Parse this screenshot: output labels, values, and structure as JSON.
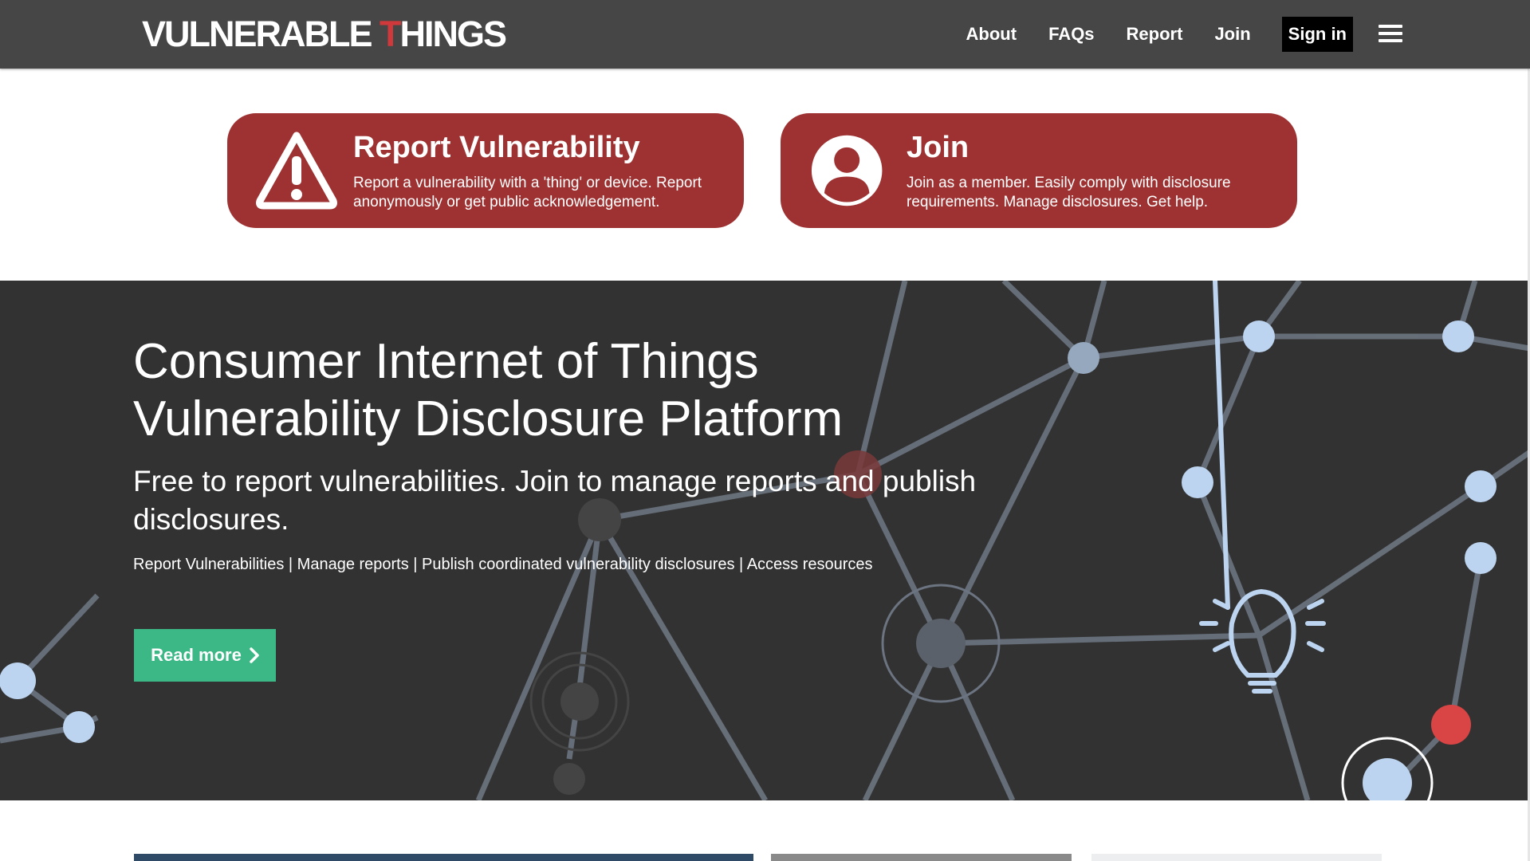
{
  "header": {
    "logo_part1": "VULNERABLE ",
    "logo_part2": "T",
    "logo_part3": "HINGS",
    "nav": [
      "About",
      "FAQs",
      "Report",
      "Join"
    ],
    "sign_in": "Sign in",
    "menu_icon": "hamburger-menu-icon"
  },
  "cards": [
    {
      "title": "Report Vulnerability",
      "description": "Report a vulnerability with a 'thing' or device. Report anonymously or get public acknowledgement.",
      "icon": "warning-triangle-icon"
    },
    {
      "title": "Join",
      "description": "Join as a member. Easily comply with disclosure requirements. Manage disclosures. Get help.",
      "icon": "user-avatar-icon"
    }
  ],
  "hero": {
    "title_line1": "Consumer Internet of Things",
    "title_line2": "Vulnerability Disclosure Platform",
    "subtitle": "Free to report vulnerabilities. Join to manage reports and publish disclosures.",
    "links": "Report Vulnerabilities | Manage reports | Publish coordinated vulnerability disclosures | Access resources",
    "read_more": "Read more"
  },
  "colors": {
    "header_bg": "#464646",
    "accent_red": "#9e3131",
    "logo_red": "#d0393b",
    "hero_bg": "#323232",
    "button_green": "#3cb786",
    "node_blue": "#bcd4ef"
  }
}
